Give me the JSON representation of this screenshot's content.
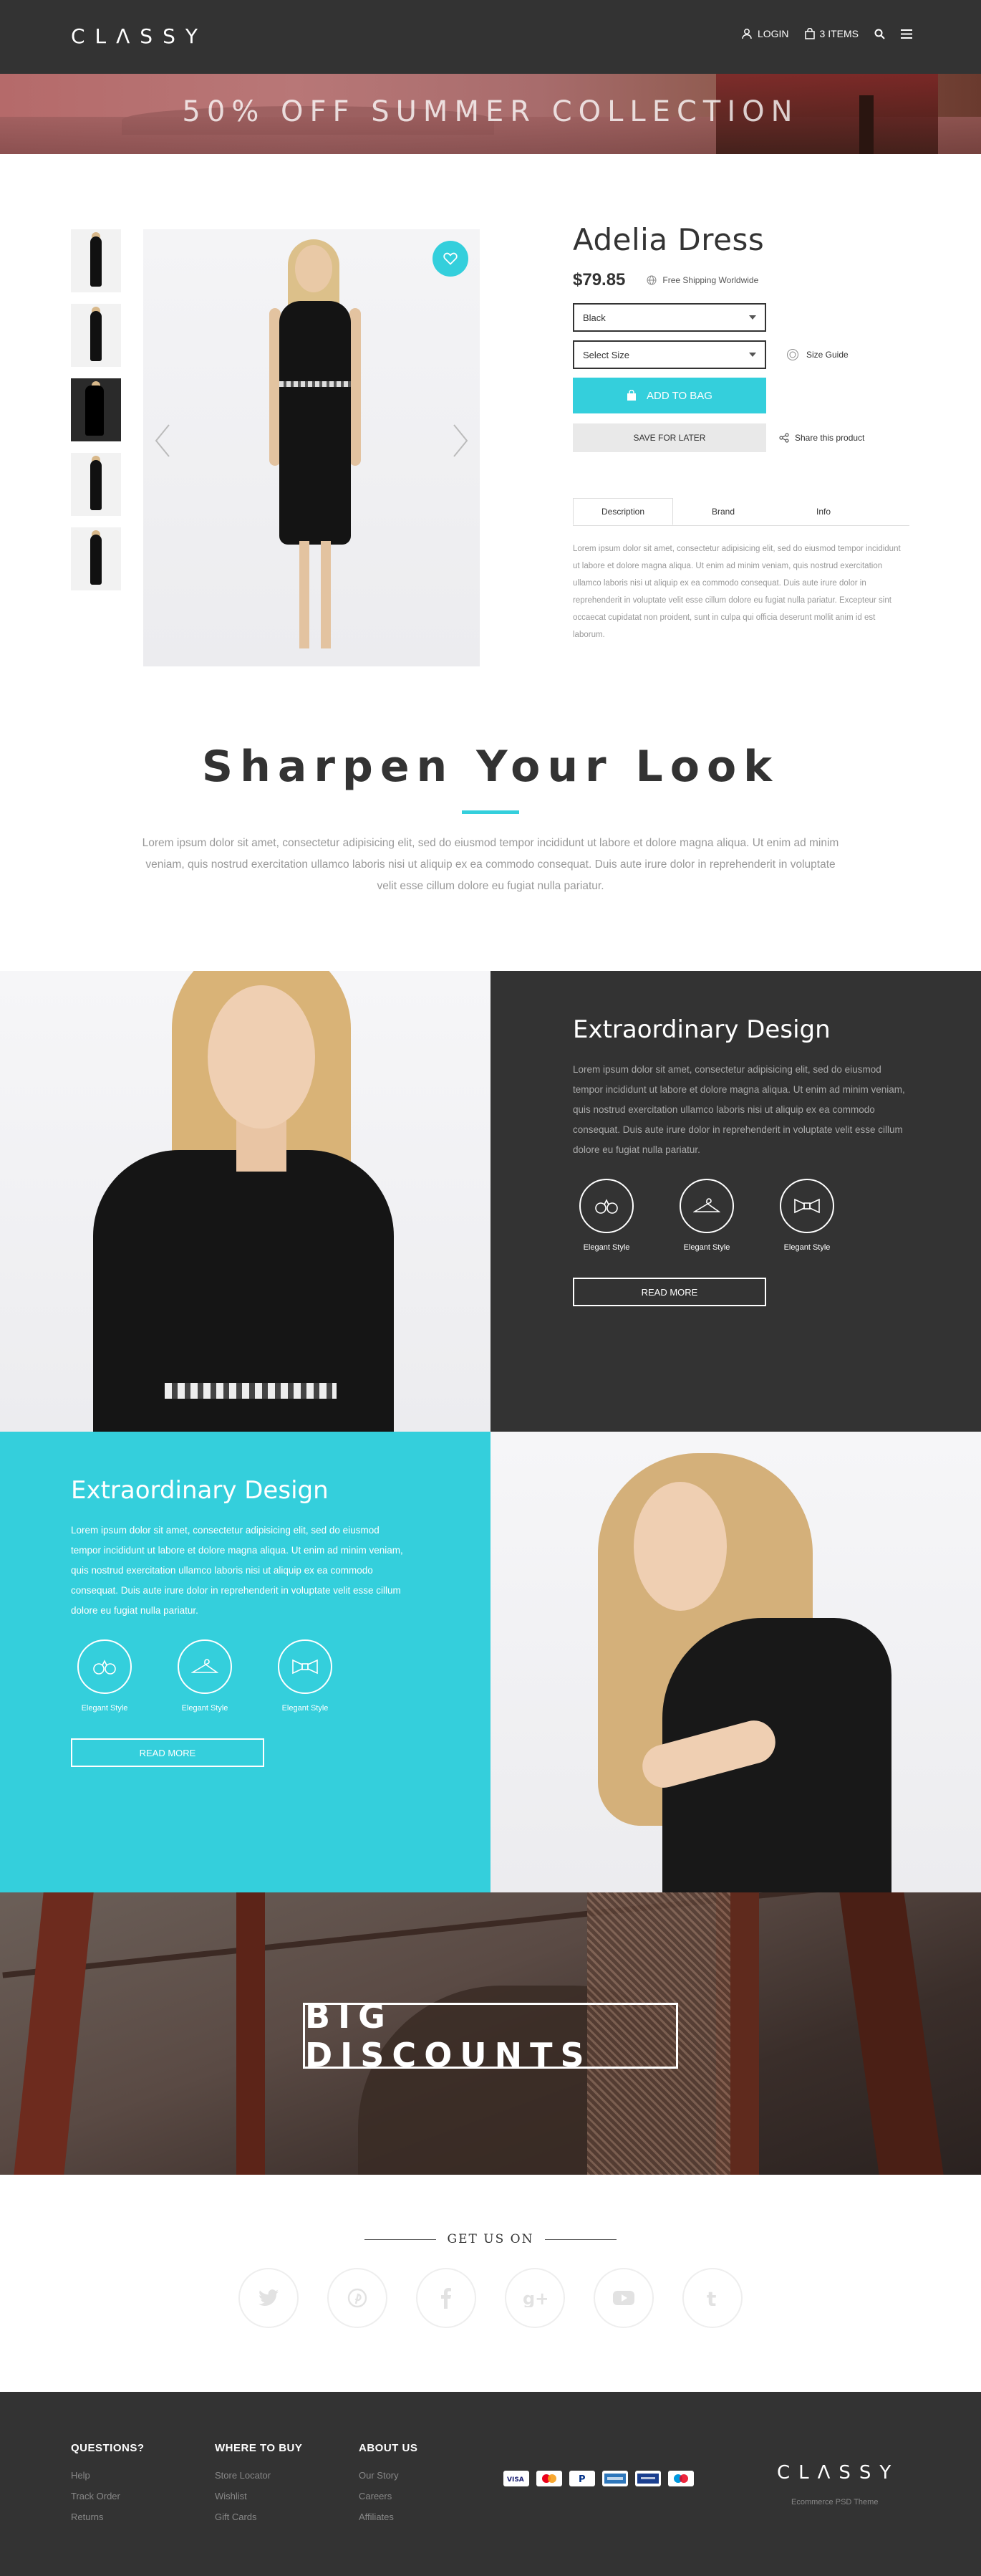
{
  "header": {
    "logo": "CLΛSSY",
    "login_label": "LOGIN",
    "cart_label": "3 ITEMS"
  },
  "promo": {
    "text": "50% OFF SUMMER COLLECTION"
  },
  "product": {
    "title": "Adelia Dress",
    "price": "$79.85",
    "shipping": "Free Shipping Worldwide",
    "color_select": "Black",
    "size_select": "Select Size",
    "size_guide": "Size Guide",
    "add_to_bag": "ADD TO BAG",
    "save_for_later": "SAVE FOR LATER",
    "share": "Share this product",
    "tabs": [
      "Description",
      "Brand",
      "Info"
    ],
    "description": "Lorem ipsum dolor sit amet, consectetur adipisicing elit, sed do eiusmod tempor incididunt ut labore et dolore magna aliqua. Ut enim ad minim veniam, quis nostrud exercitation ullamco laboris nisi ut aliquip ex ea commodo consequat. Duis aute irure dolor in reprehenderit in voluptate velit esse cillum dolore eu fugiat nulla pariatur. Excepteur sint occaecat cupidatat non proident, sunt in culpa qui officia deserunt mollit anim id est laborum."
  },
  "sharpen": {
    "title": "Sharpen Your Look",
    "text": "Lorem ipsum dolor sit amet, consectetur adipisicing elit, sed do eiusmod tempor incididunt ut labore et dolore magna aliqua. Ut enim ad minim veniam, quis nostrud exercitation ullamco laboris nisi ut aliquip ex ea commodo consequat. Duis aute irure dolor in reprehenderit in voluptate velit esse cillum dolore eu fugiat nulla pariatur."
  },
  "feature1": {
    "title": "Extraordinary Design",
    "text": "Lorem ipsum dolor sit amet, consectetur adipisicing elit, sed do eiusmod tempor incididunt ut labore et dolore magna aliqua. Ut enim ad minim veniam, quis nostrud exercitation ullamco laboris nisi ut aliquip ex ea commodo consequat. Duis aute irure dolor in reprehenderit in voluptate velit esse cillum dolore eu fugiat nulla pariatur.",
    "icon_labels": [
      "Elegant Style",
      "Elegant Style",
      "Elegant Style"
    ],
    "button": "READ MORE"
  },
  "feature2": {
    "title": "Extraordinary Design",
    "text": "Lorem ipsum dolor sit amet, consectetur adipisicing elit, sed do eiusmod tempor incididunt ut labore et dolore magna aliqua. Ut enim ad minim veniam, quis nostrud exercitation ullamco laboris nisi ut aliquip ex ea commodo consequat. Duis aute irure dolor in reprehenderit in voluptate velit esse cillum dolore eu fugiat nulla pariatur.",
    "icon_labels": [
      "Elegant Style",
      "Elegant Style",
      "Elegant Style"
    ],
    "button": "READ MORE"
  },
  "discount": {
    "text": "BIG DISCOUNTS"
  },
  "social": {
    "title": "GET US ON",
    "icons": [
      "twitter-icon",
      "pinterest-icon",
      "facebook-icon",
      "google-plus-icon",
      "youtube-icon",
      "tumblr-icon"
    ]
  },
  "footer": {
    "col1": {
      "title": "QUESTIONS?",
      "links": [
        "Help",
        "Track Order",
        "Returns"
      ]
    },
    "col2": {
      "title": "WHERE TO BUY",
      "links": [
        "Store Locator",
        "Wishlist",
        "Gift Cards"
      ]
    },
    "col3": {
      "title": "ABOUT US",
      "links": [
        "Our Story",
        "Careers",
        "Affiliates"
      ]
    },
    "logo": "CLΛSSY",
    "tagline": "Ecommerce PSD Theme"
  },
  "colors": {
    "accent": "#34cfdc",
    "dark": "#333333"
  }
}
